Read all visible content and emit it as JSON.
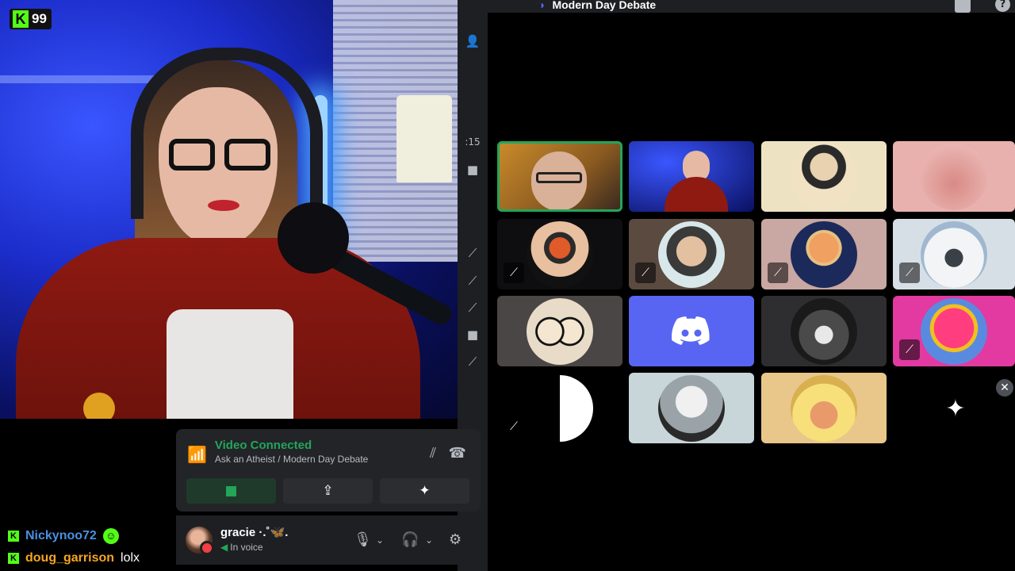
{
  "stream": {
    "viewer_count": "99",
    "kick_logo": "K"
  },
  "discord": {
    "channel_title": "Modern Day Debate",
    "channel_icon": "stage-icon",
    "side_strip": {
      "number": ":15"
    },
    "voice": {
      "status": "Video Connected",
      "location": "Ask an Atheist / Modern Day Debate",
      "status_color": "#23a55a"
    },
    "user": {
      "name": "gracie ·.˚🦋.",
      "status": "In voice"
    },
    "tiles": [
      {
        "name": "tile-speaker-man",
        "muted": false,
        "speaking": true
      },
      {
        "name": "tile-gracie-cam",
        "muted": false,
        "speaking": false
      },
      {
        "name": "tile-portrait-avatar",
        "muted": false,
        "speaking": false
      },
      {
        "name": "tile-pink-avatar",
        "muted": false,
        "speaking": false
      },
      {
        "name": "tile-sugar-skull",
        "muted": true,
        "speaking": false
      },
      {
        "name": "tile-celebrity-avatar",
        "muted": true,
        "speaking": false
      },
      {
        "name": "tile-politician-avatar",
        "muted": true,
        "speaking": false
      },
      {
        "name": "tile-snow-avatar",
        "muted": true,
        "speaking": false
      },
      {
        "name": "tile-cartoon-duo",
        "muted": false,
        "speaking": false
      },
      {
        "name": "tile-discord-default",
        "muted": false,
        "speaking": false
      },
      {
        "name": "tile-anime-avatar",
        "muted": false,
        "speaking": false
      },
      {
        "name": "tile-pink-creature",
        "muted": true,
        "speaking": false
      },
      {
        "name": "tile-yin-yang",
        "muted": true,
        "speaking": false
      },
      {
        "name": "tile-statue-avatar",
        "muted": false,
        "speaking": false
      },
      {
        "name": "tile-super-saiyan",
        "muted": false,
        "speaking": false
      },
      {
        "name": "tile-activity",
        "muted": false,
        "speaking": false
      }
    ],
    "accent": "#5865f2",
    "speaking_color": "#23a55a"
  },
  "chat": [
    {
      "user": "Nickynoo72",
      "color": "#4a90e2",
      "message": "",
      "emote": "☺"
    },
    {
      "user": "doug_garrison",
      "color": "#f5a623",
      "message": "lolx",
      "emote": ""
    }
  ]
}
